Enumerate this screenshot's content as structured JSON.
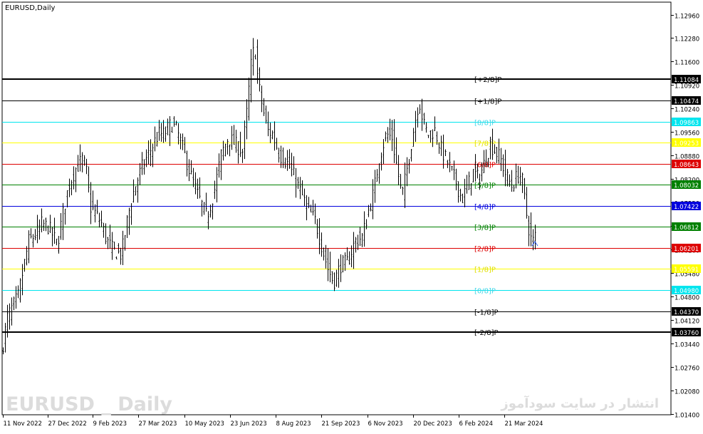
{
  "chart_data": {
    "type": "ohlc",
    "title": "EURUSD,Daily",
    "watermark_symbol": "EURUSD _ Daily",
    "watermark_site": "انتشار در سایت سودآموز",
    "ylim": [
      1.014,
      1.1296
    ],
    "y_ticks": [
      "1.12960",
      "1.12280",
      "1.11600",
      "1.10920",
      "1.10240",
      "1.09560",
      "1.08880",
      "1.08200",
      "1.07520",
      "1.06840",
      "1.06160",
      "1.05480",
      "1.04800",
      "1.04120",
      "1.03440",
      "1.02760",
      "1.02080",
      "1.01400"
    ],
    "x_tick_labels": [
      "11 Nov 2022",
      "27 Dec 2022",
      "9 Feb 2023",
      "27 Mar 2023",
      "10 May 2023",
      "23 Jun 2023",
      "8 Aug 2023",
      "21 Sep 2023",
      "6 Nov 2023",
      "20 Dec 2023",
      "6 Feb 2024",
      "21 Mar 2024"
    ],
    "murrey_levels": [
      {
        "label": "[+2/8]P",
        "value": "1.11084",
        "color": "#000000",
        "width": 2
      },
      {
        "label": "[+1/8]P",
        "value": "1.10474",
        "color": "#000000",
        "width": 1
      },
      {
        "label": "[8/8]P",
        "value": "1.09863",
        "color": "#00e5ee",
        "width": 1
      },
      {
        "label": "[7/8]P",
        "value": "1.09253",
        "color": "#ffff00",
        "width": 1
      },
      {
        "label": "[6/8]P",
        "value": "1.08643",
        "color": "#dd0000",
        "width": 1
      },
      {
        "label": "[5/8]P",
        "value": "1.08032",
        "color": "#008000",
        "width": 1
      },
      {
        "label": "[4/8]P",
        "value": "1.07422",
        "color": "#0000dd",
        "width": 1
      },
      {
        "label": "[3/8]P",
        "value": "1.06812",
        "color": "#008000",
        "width": 1
      },
      {
        "label": "[2/8]P",
        "value": "1.06201",
        "color": "#dd0000",
        "width": 1
      },
      {
        "label": "[1/8]P",
        "value": "1.05591",
        "color": "#ffff00",
        "width": 1
      },
      {
        "label": "[0/8]P",
        "value": "1.04980",
        "color": "#00e5ee",
        "width": 1
      },
      {
        "label": "[-1/8]P",
        "value": "1.04370",
        "color": "#000000",
        "width": 1
      },
      {
        "label": "[-2/8]P",
        "value": "1.03760",
        "color": "#000000",
        "width": 2
      }
    ],
    "price_path": [
      [
        0,
        1.029
      ],
      [
        10,
        1.042
      ],
      [
        25,
        1.048
      ],
      [
        40,
        1.064
      ],
      [
        50,
        1.066
      ],
      [
        58,
        1.069
      ],
      [
        68,
        1.068
      ],
      [
        80,
        1.063
      ],
      [
        88,
        1.072
      ],
      [
        96,
        1.08
      ],
      [
        106,
        1.085
      ],
      [
        116,
        1.088
      ],
      [
        122,
        1.083
      ],
      [
        126,
        1.074
      ],
      [
        134,
        1.072
      ],
      [
        142,
        1.069
      ],
      [
        150,
        1.064
      ],
      [
        160,
        1.061
      ],
      [
        170,
        1.06
      ],
      [
        180,
        1.072
      ],
      [
        188,
        1.079
      ],
      [
        198,
        1.085
      ],
      [
        210,
        1.09
      ],
      [
        222,
        1.095
      ],
      [
        230,
        1.095
      ],
      [
        240,
        1.098
      ],
      [
        248,
        1.096
      ],
      [
        256,
        1.091
      ],
      [
        266,
        1.084
      ],
      [
        278,
        1.077
      ],
      [
        290,
        1.071
      ],
      [
        300,
        1.078
      ],
      [
        310,
        1.089
      ],
      [
        320,
        1.094
      ],
      [
        330,
        1.092
      ],
      [
        340,
        1.09
      ],
      [
        346,
        1.101
      ],
      [
        352,
        1.115
      ],
      [
        357,
        1.121
      ],
      [
        362,
        1.11
      ],
      [
        368,
        1.103
      ],
      [
        375,
        1.096
      ],
      [
        382,
        1.095
      ],
      [
        392,
        1.089
      ],
      [
        402,
        1.087
      ],
      [
        412,
        1.083
      ],
      [
        422,
        1.078
      ],
      [
        432,
        1.073
      ],
      [
        442,
        1.07
      ],
      [
        452,
        1.062
      ],
      [
        460,
        1.056
      ],
      [
        468,
        1.052
      ],
      [
        478,
        1.057
      ],
      [
        488,
        1.058
      ],
      [
        498,
        1.064
      ],
      [
        508,
        1.065
      ],
      [
        516,
        1.072
      ],
      [
        524,
        1.078
      ],
      [
        532,
        1.088
      ],
      [
        542,
        1.095
      ],
      [
        550,
        1.094
      ],
      [
        558,
        1.084
      ],
      [
        564,
        1.077
      ],
      [
        572,
        1.086
      ],
      [
        580,
        1.096
      ],
      [
        588,
        1.105
      ],
      [
        594,
        1.098
      ],
      [
        600,
        1.095
      ],
      [
        610,
        1.096
      ],
      [
        620,
        1.09
      ],
      [
        630,
        1.086
      ],
      [
        640,
        1.081
      ],
      [
        648,
        1.076
      ],
      [
        656,
        1.08
      ],
      [
        664,
        1.084
      ],
      [
        672,
        1.082
      ],
      [
        680,
        1.087
      ],
      [
        688,
        1.092
      ],
      [
        695,
        1.09
      ],
      [
        702,
        1.088
      ],
      [
        710,
        1.083
      ],
      [
        718,
        1.08
      ],
      [
        726,
        1.083
      ],
      [
        732,
        1.083
      ],
      [
        738,
        1.073
      ],
      [
        744,
        1.065
      ],
      [
        748,
        1.064
      ],
      [
        752,
        1.066
      ]
    ]
  }
}
